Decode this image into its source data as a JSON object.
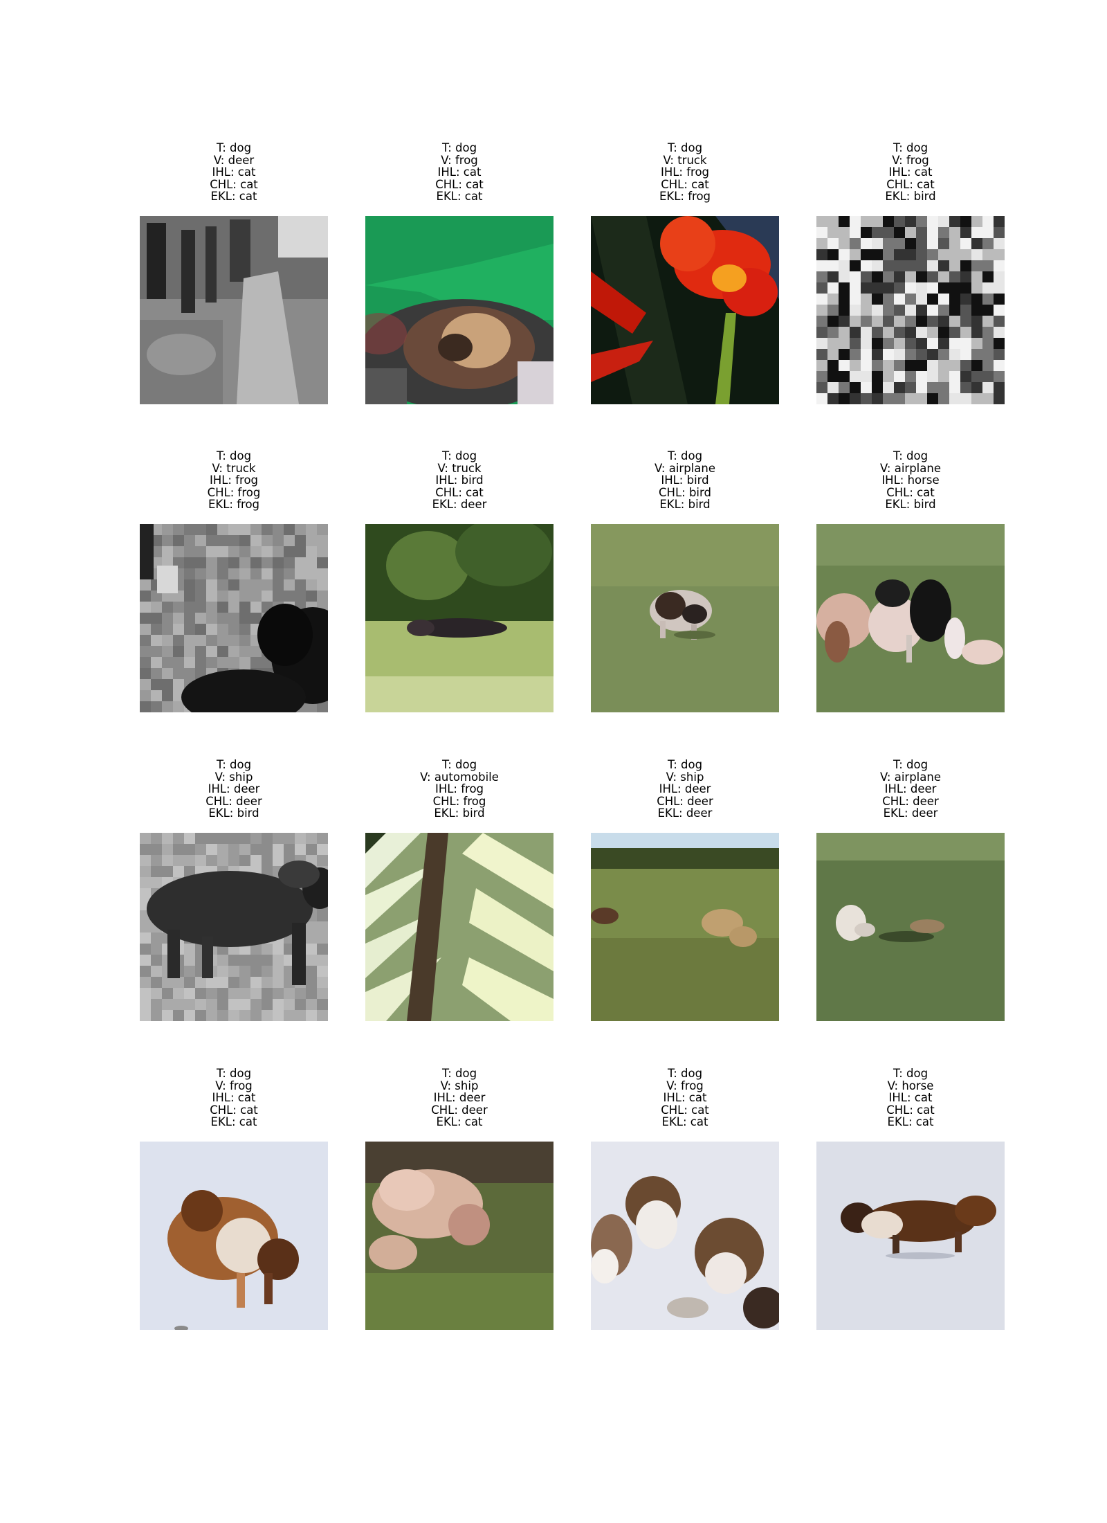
{
  "samples": [
    {
      "t": "T: dog",
      "v": "V: deer",
      "ihl": "IHL: cat",
      "chl": "CHL: cat",
      "ekl": "EKL: cat",
      "image": "grayscale-scene"
    },
    {
      "t": "T: dog",
      "v": "V: frog",
      "ihl": "IHL: cat",
      "chl": "CHL: cat",
      "ekl": "EKL: cat",
      "image": "dog-in-green-car"
    },
    {
      "t": "T: dog",
      "v": "V: truck",
      "ihl": "IHL: frog",
      "chl": "CHL: cat",
      "ekl": "EKL: frog",
      "image": "red-flower"
    },
    {
      "t": "T: dog",
      "v": "V: frog",
      "ihl": "IHL: cat",
      "chl": "CHL: cat",
      "ekl": "EKL: bird",
      "image": "noisy-texture"
    },
    {
      "t": "T: dog",
      "v": "V: truck",
      "ihl": "IHL: frog",
      "chl": "CHL: frog",
      "ekl": "EKL: frog",
      "image": "grayscale-black-dog"
    },
    {
      "t": "T: dog",
      "v": "V: truck",
      "ihl": "IHL: bird",
      "chl": "CHL: cat",
      "ekl": "EKL: deer",
      "image": "dog-on-lawn-trees"
    },
    {
      "t": "T: dog",
      "v": "V: airplane",
      "ihl": "IHL: bird",
      "chl": "CHL: bird",
      "ekl": "EKL: bird",
      "image": "dog-running-grass"
    },
    {
      "t": "T: dog",
      "v": "V: airplane",
      "ihl": "IHL: horse",
      "chl": "CHL: cat",
      "ekl": "EKL: bird",
      "image": "dogs-herding-grass"
    },
    {
      "t": "T: dog",
      "v": "V: ship",
      "ihl": "IHL: deer",
      "chl": "CHL: deer",
      "ekl": "EKL: bird",
      "image": "grayscale-dog-standing"
    },
    {
      "t": "T: dog",
      "v": "V: automobile",
      "ihl": "IHL: frog",
      "chl": "CHL: frog",
      "ekl": "EKL: bird",
      "image": "palm-leaf"
    },
    {
      "t": "T: dog",
      "v": "V: ship",
      "ihl": "IHL: deer",
      "chl": "CHL: deer",
      "ekl": "EKL: deer",
      "image": "dogs-in-field-sky"
    },
    {
      "t": "T: dog",
      "v": "V: airplane",
      "ihl": "IHL: deer",
      "chl": "CHL: deer",
      "ekl": "EKL: deer",
      "image": "white-dog-in-field"
    },
    {
      "t": "T: dog",
      "v": "V: frog",
      "ihl": "IHL: cat",
      "chl": "CHL: cat",
      "ekl": "EKL: cat",
      "image": "collie-on-snow"
    },
    {
      "t": "T: dog",
      "v": "V: ship",
      "ihl": "IHL: deer",
      "chl": "CHL: deer",
      "ekl": "EKL: cat",
      "image": "tan-dog-on-grass"
    },
    {
      "t": "T: dog",
      "v": "V: frog",
      "ihl": "IHL: cat",
      "chl": "CHL: cat",
      "ekl": "EKL: cat",
      "image": "three-collies-snow"
    },
    {
      "t": "T: dog",
      "v": "V: horse",
      "ihl": "IHL: cat",
      "chl": "CHL: cat",
      "ekl": "EKL: cat",
      "image": "collie-running-snow"
    }
  ]
}
